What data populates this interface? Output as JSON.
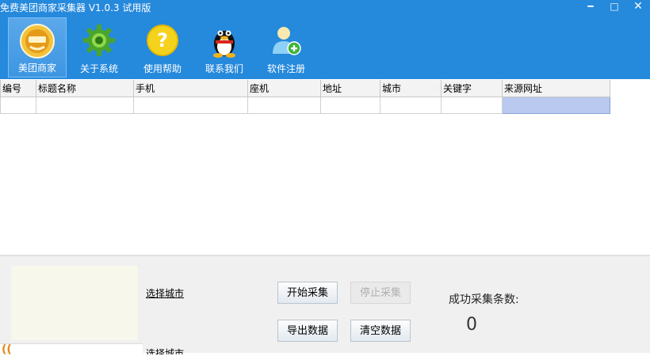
{
  "window": {
    "title": "免费美团商家采集器 V1.0.3 试用版",
    "minimize": "━",
    "maximize": "□",
    "close": "✕"
  },
  "toolbar": [
    {
      "label": "美团商家",
      "icon": "meituan-logo-icon",
      "active": true
    },
    {
      "label": "关于系统",
      "icon": "gear-icon",
      "active": false
    },
    {
      "label": "使用帮助",
      "icon": "help-icon",
      "active": false
    },
    {
      "label": "联系我们",
      "icon": "qq-penguin-icon",
      "active": false
    },
    {
      "label": "软件注册",
      "icon": "user-register-icon",
      "active": false
    }
  ],
  "grid": {
    "columns": [
      "编号",
      "标题名称",
      "手机",
      "座机",
      "地址",
      "城市",
      "关键字",
      "来源网址"
    ]
  },
  "bottom": {
    "select_city": "选择城市",
    "start_button": "开始采集",
    "stop_button": "停止采集",
    "export_button": "导出数据",
    "clear_button": "清空数据",
    "success_label": "成功采集条数:",
    "success_count": "0"
  },
  "colors": {
    "toolbar_bg": "#2589dc",
    "selected_cell": "#b9c9ef"
  }
}
